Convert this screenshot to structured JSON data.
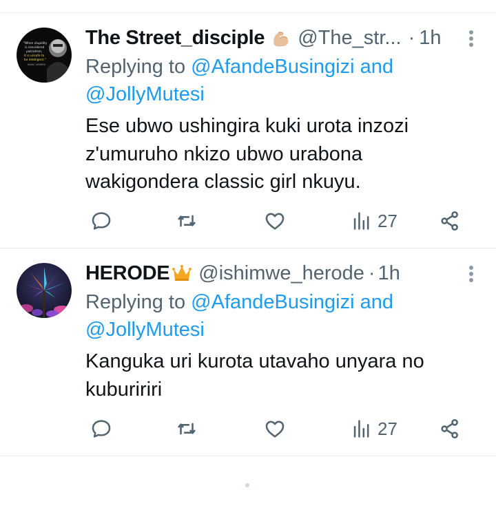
{
  "tweets": [
    {
      "display_name": "The Street_disciple",
      "badge_icon": "flexed-biceps-emoji",
      "handle": "@The_str...",
      "separator": "·",
      "time": "1h",
      "avatar_icon": "quote-portrait-avatar",
      "avatar_text": [
        "\"When stupidity",
        "is considered",
        "patriotism,",
        "it is unsafe to",
        "be intelligent.\"",
        "ISAAC ASIMOV"
      ],
      "reply_prefix": "Replying to ",
      "reply_to_1": "@AfandeBusingizi",
      "reply_and": " and",
      "reply_to_2": "@JollyMutesi",
      "text": "Ese ubwo ushingira kuki urota inzozi z'umuruho nkizo ubwo urabona wakigondera classic girl nkuyu.",
      "views": "27"
    },
    {
      "display_name": "HERODE",
      "badge_icon": "crown-emoji",
      "handle": "@ishimwe_herode",
      "separator": "·",
      "time": "1h",
      "avatar_icon": "flower-art-avatar",
      "reply_prefix": "Replying to ",
      "reply_to_1": "@AfandeBusingizi",
      "reply_and": " and",
      "reply_to_2": "@JollyMutesi",
      "text": "Kanguka uri kurota utavaho unyara no kubuririri",
      "views": "27"
    }
  ],
  "colors": {
    "link": "#1d9bf0",
    "secondary_text": "#536471",
    "primary_text": "#0f1419"
  }
}
